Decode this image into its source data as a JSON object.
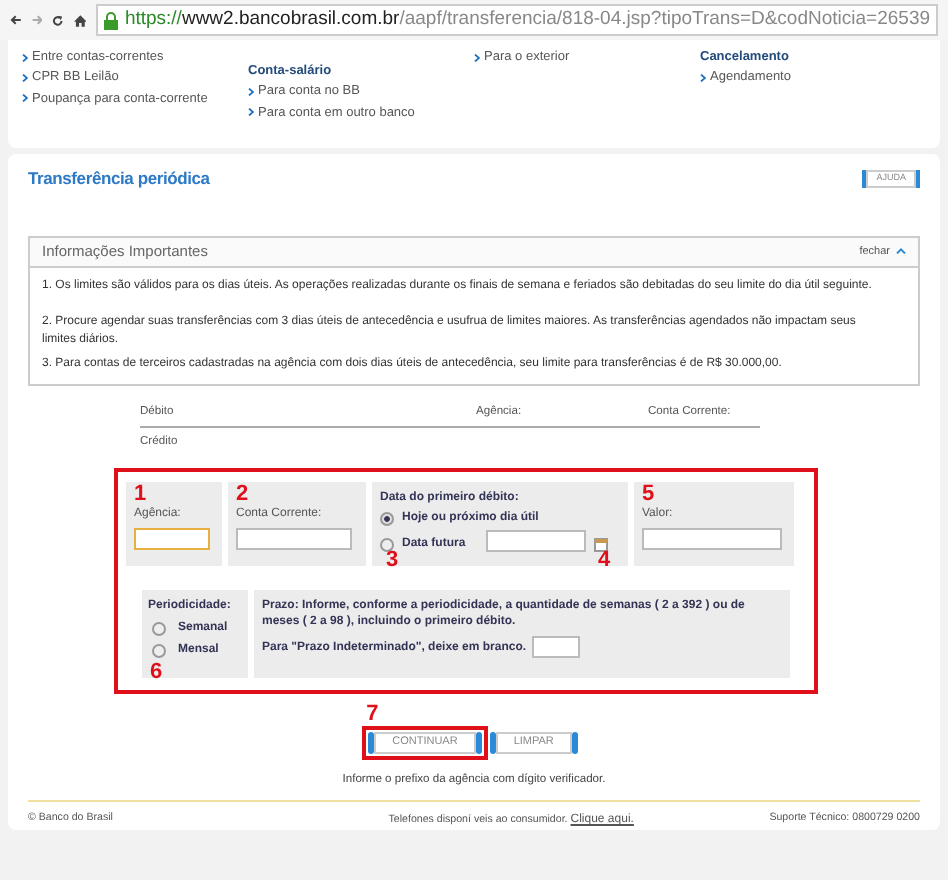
{
  "browser": {
    "url_scheme": "https://",
    "url_host": "www2.bancobrasil.com.br",
    "url_path": "/aapf/transferencia/818-04.jsp?tipoTrans=D&codNoticia=26539"
  },
  "menu_columns": [
    {
      "links": [
        "Entre contas-correntes",
        "CPR BB Leilão",
        "Poupança para conta-corrente"
      ]
    },
    {
      "heading": "Conta-salário",
      "links": [
        "Para conta no BB",
        "Para conta em outro banco"
      ]
    },
    {
      "links": [
        "Para o exterior"
      ]
    },
    {
      "heading": "Cancelamento",
      "links": [
        "Agendamento"
      ]
    }
  ],
  "page_title": "Transferência periódica",
  "help_button": "AJUDA",
  "info": {
    "title": "Informações Importantes",
    "close_link": "fechar",
    "expanded": true,
    "items": [
      "1. Os limites são válidos para os dias úteis. As operações realizadas durante os finais de semana e feriados são debitadas do seu limite do dia útil seguinte.",
      "2. Procure agendar suas transferências com 3 dias úteis de antecedência e usufrua de limites maiores. As transferências agendados não impactam seus limites diários.",
      "3. Para contas de terceiros cadastradas na agência com dois dias úteis de antecedência, seu limite para transferências é de R$ 30.000,00."
    ]
  },
  "summary": {
    "debit_label": "Débito",
    "agency_label": "Agência:",
    "account_label": "Conta Corrente:",
    "credit_label": "Crédito"
  },
  "form": {
    "agency": {
      "marker": "1",
      "label": "Agência:",
      "focused": true
    },
    "account": {
      "marker": "2",
      "label": "Conta Corrente:",
      "focused": false
    },
    "date": {
      "label": "Data do primeiro débito:",
      "options": [
        {
          "label": "Hoje ou próximo dia útil",
          "selected": true
        },
        {
          "label": "Data futura",
          "selected": false
        }
      ],
      "marker_option": "3",
      "marker_calendar": "4"
    },
    "value": {
      "marker": "5",
      "label": "Valor:"
    },
    "periodicity": {
      "label": "Periodicidade:",
      "options": [
        {
          "label": "Semanal",
          "selected": false
        },
        {
          "label": "Mensal",
          "selected": false
        }
      ],
      "marker": "6"
    },
    "term": {
      "text": "Prazo:  Informe, conforme a periodicidade, a quantidade de semanas ( 2 a 392 ) ou de meses ( 2 a 98 ), incluindo o primeiro débito.",
      "blank_hint": "Para \"Prazo Indeterminado\", deixe em branco."
    }
  },
  "buttons": [
    {
      "label": "CONTINUAR",
      "marker": "7"
    },
    {
      "label": "LIMPAR"
    }
  ],
  "hint": "Informe o prefixo da agência com dígito verificador.",
  "footer": {
    "copyright": "© Banco do Brasil",
    "phones": "Telefones disponí veis ao consumidor.",
    "phones_link": "Clique aqui.",
    "support": "Suporte Técnico: 0800729 0200"
  }
}
